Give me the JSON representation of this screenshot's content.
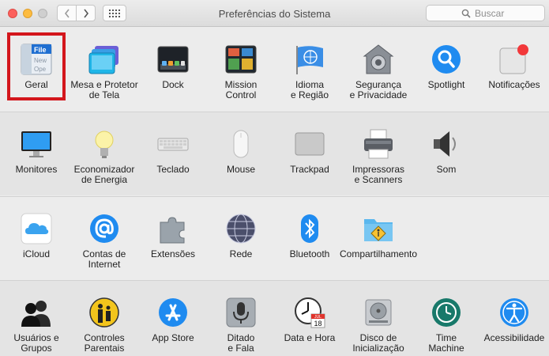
{
  "window": {
    "title": "Preferências do Sistema",
    "search_placeholder": "Buscar"
  },
  "toolbar": {
    "back_icon": "chevron-left-icon",
    "forward_icon": "chevron-right-icon",
    "show_all_icon": "grid-icon"
  },
  "rows": [
    {
      "items": [
        {
          "label": "Geral",
          "icon": "general-icon",
          "selected": true
        },
        {
          "label": "Mesa e Protetor\nde Tela",
          "icon": "desktop-screensaver-icon"
        },
        {
          "label": "Dock",
          "icon": "dock-icon"
        },
        {
          "label": "Mission\nControl",
          "icon": "mission-control-icon"
        },
        {
          "label": "Idioma\ne Região",
          "icon": "language-region-icon"
        },
        {
          "label": "Segurança\ne Privacidade",
          "icon": "security-privacy-icon"
        },
        {
          "label": "Spotlight",
          "icon": "spotlight-icon"
        },
        {
          "label": "Notificações",
          "icon": "notifications-icon"
        }
      ]
    },
    {
      "items": [
        {
          "label": "Monitores",
          "icon": "displays-icon"
        },
        {
          "label": "Economizador\nde Energia",
          "icon": "energy-saver-icon"
        },
        {
          "label": "Teclado",
          "icon": "keyboard-icon"
        },
        {
          "label": "Mouse",
          "icon": "mouse-icon"
        },
        {
          "label": "Trackpad",
          "icon": "trackpad-icon"
        },
        {
          "label": "Impressoras\ne Scanners",
          "icon": "printer-icon"
        },
        {
          "label": "Som",
          "icon": "sound-icon"
        }
      ]
    },
    {
      "items": [
        {
          "label": "iCloud",
          "icon": "icloud-icon"
        },
        {
          "label": "Contas de\nInternet",
          "icon": "internet-accounts-icon"
        },
        {
          "label": "Extensões",
          "icon": "extensions-icon"
        },
        {
          "label": "Rede",
          "icon": "network-icon"
        },
        {
          "label": "Bluetooth",
          "icon": "bluetooth-icon"
        },
        {
          "label": "Compartilhamento",
          "icon": "sharing-icon"
        }
      ]
    },
    {
      "items": [
        {
          "label": "Usuários e\nGrupos",
          "icon": "users-groups-icon"
        },
        {
          "label": "Controles\nParentais",
          "icon": "parental-controls-icon"
        },
        {
          "label": "App Store",
          "icon": "app-store-icon"
        },
        {
          "label": "Ditado\ne Fala",
          "icon": "dictation-speech-icon"
        },
        {
          "label": "Data e Hora",
          "icon": "date-time-icon"
        },
        {
          "label": "Disco de\nInicialização",
          "icon": "startup-disk-icon"
        },
        {
          "label": "Time\nMachine",
          "icon": "time-machine-icon"
        },
        {
          "label": "Acessibilidade",
          "icon": "accessibility-icon"
        }
      ]
    }
  ],
  "icon_text": {
    "general": [
      "File",
      "New",
      "Ope"
    ],
    "calendar_month": "JUL",
    "calendar_day": "18"
  },
  "colors": {
    "highlight": "#d3161c",
    "accent_blue": "#1f8bf0"
  }
}
